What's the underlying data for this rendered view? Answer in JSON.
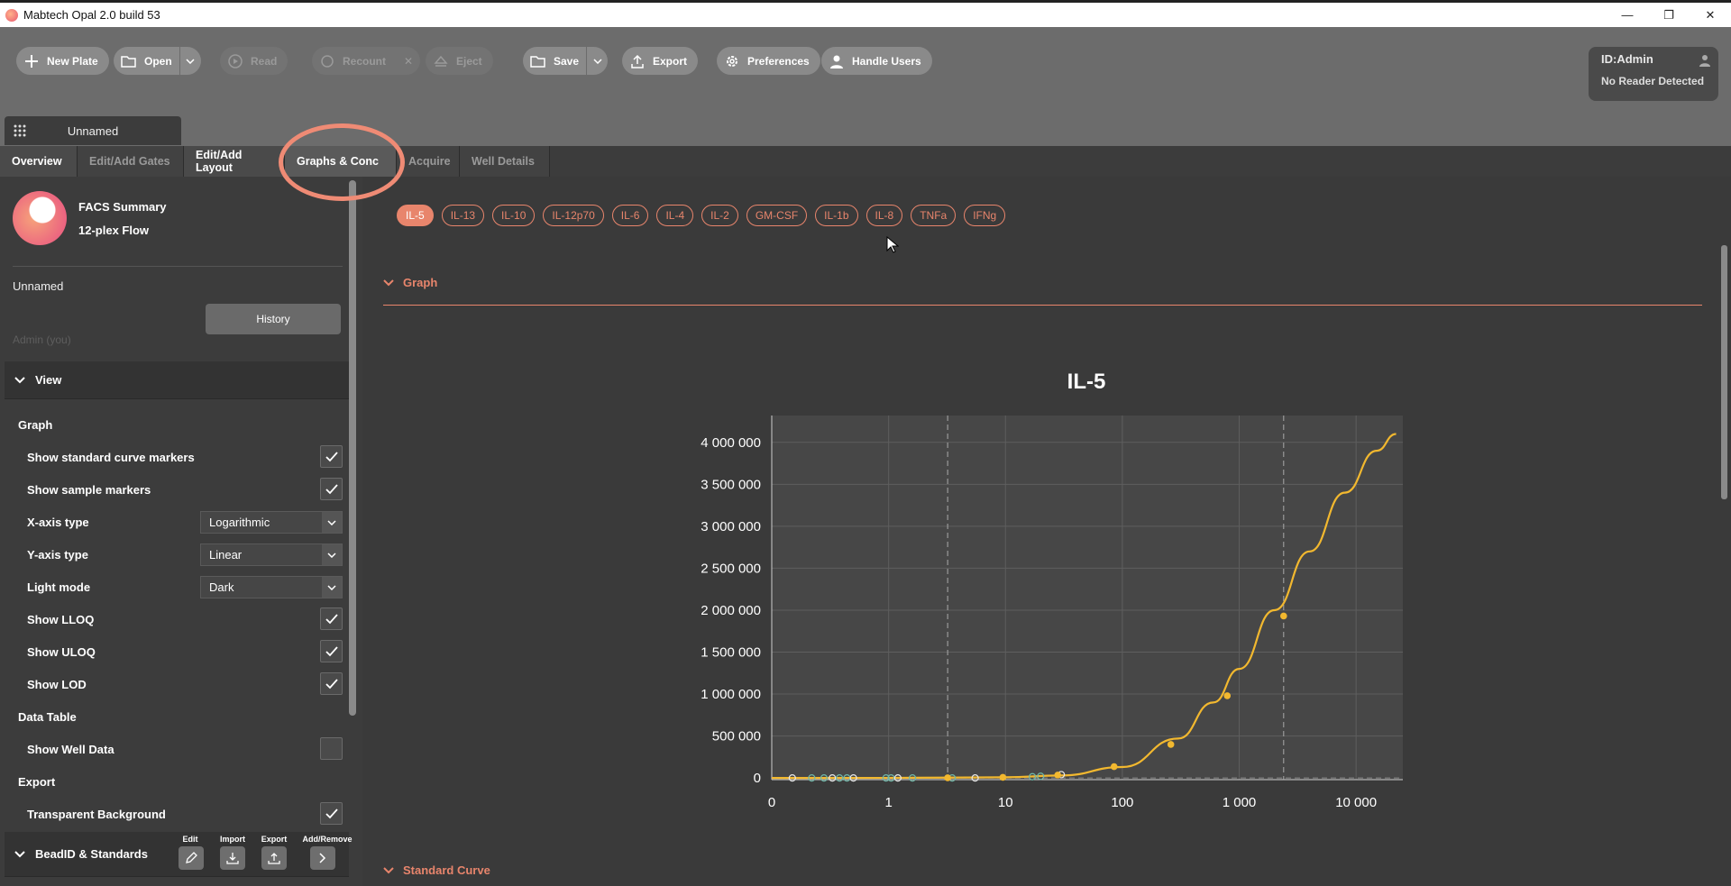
{
  "window": {
    "title": "Mabtech Opal 2.0 build 53",
    "controls": [
      "—",
      "❐",
      "✕"
    ]
  },
  "toolbar": {
    "new_plate": "New Plate",
    "open": "Open",
    "read": "Read",
    "recount": "Recount",
    "eject": "Eject",
    "save": "Save",
    "export": "Export",
    "preferences": "Preferences",
    "handle_users": "Handle Users"
  },
  "user": {
    "id": "ID:Admin",
    "reader": "No Reader Detected"
  },
  "doc_tab": {
    "label": "Unnamed"
  },
  "tabs": [
    "Overview",
    "Edit/Add Gates",
    "Edit/Add Layout",
    "Graphs & Conc",
    "Acquire",
    "Well Details"
  ],
  "sidebar": {
    "summary_title": "FACS Summary",
    "summary_sub": "12-plex Flow",
    "plate_name": "Unnamed",
    "history": "History",
    "owner": "Admin (you)",
    "view_section": "View",
    "graph_group": "Graph",
    "options": {
      "std_markers": "Show standard curve markers",
      "sample_markers": "Show sample markers",
      "x_axis": "X-axis type",
      "x_axis_value": "Logarithmic",
      "y_axis": "Y-axis type",
      "y_axis_value": "Linear",
      "light_mode": "Light mode",
      "light_mode_value": "Dark",
      "lloq": "Show LLOQ",
      "uloq": "Show ULOQ",
      "lod": "Show LOD"
    },
    "data_table_group": "Data Table",
    "show_well_data": "Show Well Data",
    "export_group": "Export",
    "transparent_bg": "Transparent Background",
    "bead_section": "BeadID & Standards",
    "bead_tools": {
      "edit": "Edit",
      "import": "Import",
      "export": "Export",
      "add_remove": "Add/Remove"
    }
  },
  "analytes": [
    "IL-5",
    "IL-13",
    "IL-10",
    "IL-12p70",
    "IL-6",
    "IL-4",
    "IL-2",
    "GM-CSF",
    "IL-1b",
    "IL-8",
    "TNFa",
    "IFNg"
  ],
  "graph_section": "Graph",
  "standard_curve_section": "Standard Curve",
  "colors": {
    "accent": "#e8856c",
    "curve": "#f2b82f"
  },
  "chart_data": {
    "type": "line",
    "title": "IL-5",
    "x_scale": "log",
    "x_tick_labels": [
      "0",
      "1",
      "10",
      "100",
      "1 000",
      "10 000"
    ],
    "y_tick_labels": [
      "0",
      "500 000",
      "1 000 000",
      "1 500 000",
      "2 000 000",
      "2 500 000",
      "3 000 000",
      "3 500 000",
      "4 000 000"
    ],
    "ylim": [
      0,
      4000000
    ],
    "vlines": [
      3.2,
      2400
    ],
    "curve": {
      "x": [
        0.1,
        1,
        10,
        30,
        100,
        300,
        600,
        1000,
        2000,
        4000,
        8000,
        15000,
        22000
      ],
      "y": [
        0,
        1000,
        8000,
        30000,
        130000,
        470000,
        900000,
        1300000,
        2000000,
        2700000,
        3400000,
        3900000,
        4100000
      ]
    },
    "standards": {
      "x": [
        3.2,
        9.5,
        28,
        85,
        260,
        790,
        2400
      ],
      "y": [
        2000,
        8000,
        35000,
        135000,
        400000,
        980000,
        1930000
      ]
    },
    "samples": {
      "x": [
        0.15,
        0.22,
        0.28,
        0.33,
        0.38,
        0.44,
        0.5,
        0.95,
        1.05,
        1.2,
        1.6,
        3.5,
        5.5,
        17,
        20,
        30
      ],
      "y": [
        0,
        0,
        0,
        0,
        0,
        0,
        0,
        0,
        0,
        0,
        0,
        0,
        0,
        15000,
        20000,
        40000
      ]
    }
  }
}
